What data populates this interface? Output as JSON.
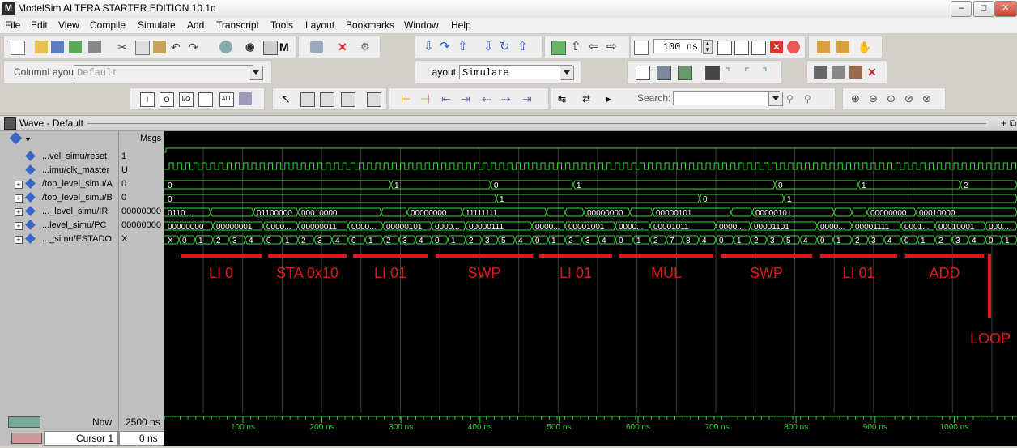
{
  "window": {
    "title": "ModelSim ALTERA STARTER EDITION 10.1d",
    "logo": "M"
  },
  "menu": [
    "File",
    "Edit",
    "View",
    "Compile",
    "Simulate",
    "Add",
    "Transcript",
    "Tools",
    "Layout",
    "Bookmarks",
    "Window",
    "Help"
  ],
  "toolbar": {
    "zoom_value": "100 ns",
    "column_layout_label": "ColumnLayout",
    "column_layout_value": "Default",
    "layout_label": "Layout",
    "layout_value": "Simulate",
    "search_label": "Search:"
  },
  "wave_window": {
    "title": "Wave - Default",
    "msgs_header": "Msgs"
  },
  "signals": [
    {
      "name": "...vel_simu/reset",
      "value": "1",
      "expandable": false
    },
    {
      "name": "...imu/clk_master",
      "value": "U",
      "expandable": false
    },
    {
      "name": "/top_level_simu/A",
      "value": "0",
      "expandable": true
    },
    {
      "name": "/top_level_simu/B",
      "value": "0",
      "expandable": true
    },
    {
      "name": "..._level_simu/IR",
      "value": "00000000",
      "expandable": true
    },
    {
      "name": "...level_simu/PC",
      "value": "00000000",
      "expandable": true
    },
    {
      "name": "..._simu/ESTADO",
      "value": "X",
      "expandable": true
    }
  ],
  "waves": {
    "a": [
      {
        "t": 0,
        "v": "0"
      },
      {
        "t": 280,
        "v": "1"
      },
      {
        "t": 403,
        "v": "0"
      },
      {
        "t": 505,
        "v": "1"
      },
      {
        "t": 754,
        "v": "0"
      },
      {
        "t": 857,
        "v": "1"
      },
      {
        "t": 983,
        "v": "2"
      }
    ],
    "b": [
      {
        "t": 0,
        "v": "0"
      },
      {
        "t": 410,
        "v": "1"
      },
      {
        "t": 661,
        "v": "0"
      },
      {
        "t": 765,
        "v": "1"
      }
    ],
    "ir": [
      {
        "t": 0,
        "v": "0110..."
      },
      {
        "t": 57,
        "v": ""
      },
      {
        "t": 110,
        "v": "01100000"
      },
      {
        "t": 165,
        "v": "00010000"
      },
      {
        "t": 268,
        "v": ""
      },
      {
        "t": 300,
        "v": "00000000"
      },
      {
        "t": 368,
        "v": "11111111"
      },
      {
        "t": 472,
        "v": ""
      },
      {
        "t": 495,
        "v": ""
      },
      {
        "t": 518,
        "v": "00000000"
      },
      {
        "t": 575,
        "v": ""
      },
      {
        "t": 603,
        "v": "00000101"
      },
      {
        "t": 700,
        "v": ""
      },
      {
        "t": 726,
        "v": "00000101"
      },
      {
        "t": 827,
        "v": ""
      },
      {
        "t": 849,
        "v": ""
      },
      {
        "t": 868,
        "v": "00000000"
      },
      {
        "t": 928,
        "v": "00010000"
      }
    ],
    "pc": [
      {
        "t": 0,
        "v": "00000000"
      },
      {
        "t": 60,
        "v": "00000001"
      },
      {
        "t": 122,
        "v": "0000..."
      },
      {
        "t": 165,
        "v": "00000011"
      },
      {
        "t": 227,
        "v": "0000..."
      },
      {
        "t": 270,
        "v": "00000101"
      },
      {
        "t": 330,
        "v": "0000..."
      },
      {
        "t": 372,
        "v": "00000111"
      },
      {
        "t": 454,
        "v": "0000..."
      },
      {
        "t": 495,
        "v": "00001001"
      },
      {
        "t": 557,
        "v": "0000..."
      },
      {
        "t": 600,
        "v": "00001011"
      },
      {
        "t": 681,
        "v": "0000..."
      },
      {
        "t": 724,
        "v": "00001101"
      },
      {
        "t": 806,
        "v": "0000..."
      },
      {
        "t": 849,
        "v": "00001111"
      },
      {
        "t": 910,
        "v": "0001..."
      },
      {
        "t": 952,
        "v": "00010001"
      },
      {
        "t": 1014,
        "v": "000..."
      }
    ],
    "estado": [
      {
        "t": 0,
        "v": "X"
      },
      {
        "t": 18,
        "v": "0"
      },
      {
        "t": 38,
        "v": "1"
      },
      {
        "t": 60,
        "v": "2"
      },
      {
        "t": 80,
        "v": "3"
      },
      {
        "t": 100,
        "v": "4"
      },
      {
        "t": 122,
        "v": "0"
      },
      {
        "t": 145,
        "v": "1"
      },
      {
        "t": 165,
        "v": "2"
      },
      {
        "t": 185,
        "v": "3"
      },
      {
        "t": 207,
        "v": "4"
      },
      {
        "t": 227,
        "v": "0"
      },
      {
        "t": 248,
        "v": "1"
      },
      {
        "t": 270,
        "v": "2"
      },
      {
        "t": 290,
        "v": "3"
      },
      {
        "t": 310,
        "v": "4"
      },
      {
        "t": 330,
        "v": "0"
      },
      {
        "t": 350,
        "v": "1"
      },
      {
        "t": 372,
        "v": "2"
      },
      {
        "t": 392,
        "v": "3"
      },
      {
        "t": 412,
        "v": "5"
      },
      {
        "t": 433,
        "v": "4"
      },
      {
        "t": 454,
        "v": "0"
      },
      {
        "t": 474,
        "v": "1"
      },
      {
        "t": 495,
        "v": "2"
      },
      {
        "t": 516,
        "v": "3"
      },
      {
        "t": 536,
        "v": "4"
      },
      {
        "t": 557,
        "v": "0"
      },
      {
        "t": 579,
        "v": "1"
      },
      {
        "t": 600,
        "v": "2"
      },
      {
        "t": 620,
        "v": "7"
      },
      {
        "t": 640,
        "v": "8"
      },
      {
        "t": 660,
        "v": "4"
      },
      {
        "t": 681,
        "v": "0"
      },
      {
        "t": 703,
        "v": "1"
      },
      {
        "t": 724,
        "v": "2"
      },
      {
        "t": 744,
        "v": "3"
      },
      {
        "t": 764,
        "v": "5"
      },
      {
        "t": 785,
        "v": "4"
      },
      {
        "t": 806,
        "v": "0"
      },
      {
        "t": 826,
        "v": "1"
      },
      {
        "t": 849,
        "v": "2"
      },
      {
        "t": 869,
        "v": "3"
      },
      {
        "t": 889,
        "v": "4"
      },
      {
        "t": 910,
        "v": "0"
      },
      {
        "t": 930,
        "v": "1"
      },
      {
        "t": 952,
        "v": "2"
      },
      {
        "t": 973,
        "v": "3"
      },
      {
        "t": 993,
        "v": "4"
      },
      {
        "t": 1014,
        "v": "0"
      },
      {
        "t": 1034,
        "v": "1"
      }
    ]
  },
  "annotations": [
    {
      "label": "LI 0",
      "t0": 20,
      "t1": 120
    },
    {
      "label": "STA 0x10",
      "t0": 128,
      "t1": 225
    },
    {
      "label": "LI 01",
      "t0": 233,
      "t1": 325
    },
    {
      "label": "SWP",
      "t0": 335,
      "t1": 455
    },
    {
      "label": "LI 01",
      "t0": 463,
      "t1": 553
    },
    {
      "label": "MUL",
      "t0": 562,
      "t1": 678
    },
    {
      "label": "SWP",
      "t0": 687,
      "t1": 800
    },
    {
      "label": "LI 01",
      "t0": 810,
      "t1": 905
    },
    {
      "label": "ADD",
      "t0": 915,
      "t1": 1012
    },
    {
      "label": "LOOP",
      "t0": 1019,
      "t1": 1019
    }
  ],
  "timeline": {
    "ticks": [
      "100 ns",
      "200 ns",
      "300 ns",
      "400 ns",
      "500 ns",
      "600 ns",
      "700 ns",
      "800 ns",
      "900 ns",
      "1000 ns"
    ],
    "now_label": "Now",
    "now_value": "2500 ns",
    "cursor_label": "Cursor 1",
    "cursor_value": "0 ns"
  },
  "colors": {
    "wave_green": "#3cd83c",
    "annotation_red": "#e01818",
    "wave_bg": "#000000",
    "grid": "#3a3a3a"
  }
}
